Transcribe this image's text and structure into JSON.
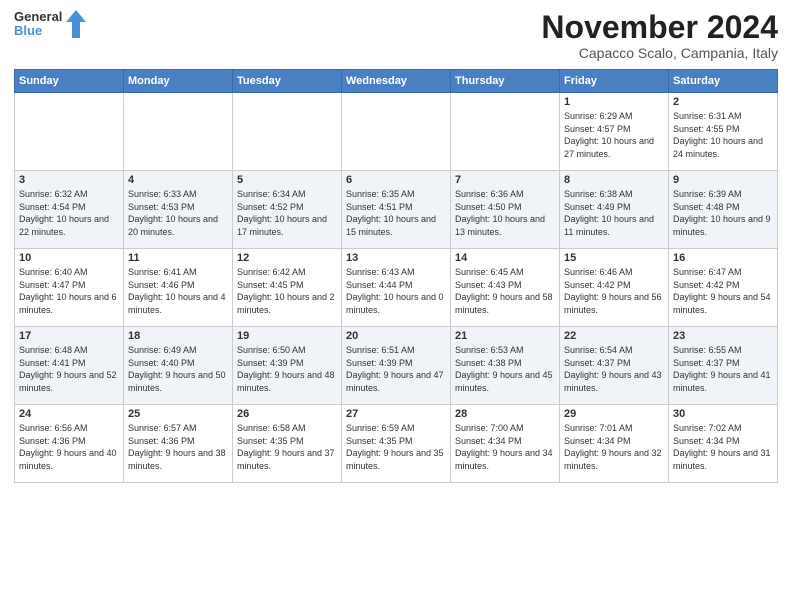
{
  "header": {
    "logo_general": "General",
    "logo_blue": "Blue",
    "month_title": "November 2024",
    "location": "Capacco Scalo, Campania, Italy"
  },
  "weekdays": [
    "Sunday",
    "Monday",
    "Tuesday",
    "Wednesday",
    "Thursday",
    "Friday",
    "Saturday"
  ],
  "weeks": [
    [
      {
        "day": "",
        "sunrise": "",
        "sunset": "",
        "daylight": ""
      },
      {
        "day": "",
        "sunrise": "",
        "sunset": "",
        "daylight": ""
      },
      {
        "day": "",
        "sunrise": "",
        "sunset": "",
        "daylight": ""
      },
      {
        "day": "",
        "sunrise": "",
        "sunset": "",
        "daylight": ""
      },
      {
        "day": "",
        "sunrise": "",
        "sunset": "",
        "daylight": ""
      },
      {
        "day": "1",
        "sunrise": "Sunrise: 6:29 AM",
        "sunset": "Sunset: 4:57 PM",
        "daylight": "Daylight: 10 hours and 27 minutes."
      },
      {
        "day": "2",
        "sunrise": "Sunrise: 6:31 AM",
        "sunset": "Sunset: 4:55 PM",
        "daylight": "Daylight: 10 hours and 24 minutes."
      }
    ],
    [
      {
        "day": "3",
        "sunrise": "Sunrise: 6:32 AM",
        "sunset": "Sunset: 4:54 PM",
        "daylight": "Daylight: 10 hours and 22 minutes."
      },
      {
        "day": "4",
        "sunrise": "Sunrise: 6:33 AM",
        "sunset": "Sunset: 4:53 PM",
        "daylight": "Daylight: 10 hours and 20 minutes."
      },
      {
        "day": "5",
        "sunrise": "Sunrise: 6:34 AM",
        "sunset": "Sunset: 4:52 PM",
        "daylight": "Daylight: 10 hours and 17 minutes."
      },
      {
        "day": "6",
        "sunrise": "Sunrise: 6:35 AM",
        "sunset": "Sunset: 4:51 PM",
        "daylight": "Daylight: 10 hours and 15 minutes."
      },
      {
        "day": "7",
        "sunrise": "Sunrise: 6:36 AM",
        "sunset": "Sunset: 4:50 PM",
        "daylight": "Daylight: 10 hours and 13 minutes."
      },
      {
        "day": "8",
        "sunrise": "Sunrise: 6:38 AM",
        "sunset": "Sunset: 4:49 PM",
        "daylight": "Daylight: 10 hours and 11 minutes."
      },
      {
        "day": "9",
        "sunrise": "Sunrise: 6:39 AM",
        "sunset": "Sunset: 4:48 PM",
        "daylight": "Daylight: 10 hours and 9 minutes."
      }
    ],
    [
      {
        "day": "10",
        "sunrise": "Sunrise: 6:40 AM",
        "sunset": "Sunset: 4:47 PM",
        "daylight": "Daylight: 10 hours and 6 minutes."
      },
      {
        "day": "11",
        "sunrise": "Sunrise: 6:41 AM",
        "sunset": "Sunset: 4:46 PM",
        "daylight": "Daylight: 10 hours and 4 minutes."
      },
      {
        "day": "12",
        "sunrise": "Sunrise: 6:42 AM",
        "sunset": "Sunset: 4:45 PM",
        "daylight": "Daylight: 10 hours and 2 minutes."
      },
      {
        "day": "13",
        "sunrise": "Sunrise: 6:43 AM",
        "sunset": "Sunset: 4:44 PM",
        "daylight": "Daylight: 10 hours and 0 minutes."
      },
      {
        "day": "14",
        "sunrise": "Sunrise: 6:45 AM",
        "sunset": "Sunset: 4:43 PM",
        "daylight": "Daylight: 9 hours and 58 minutes."
      },
      {
        "day": "15",
        "sunrise": "Sunrise: 6:46 AM",
        "sunset": "Sunset: 4:42 PM",
        "daylight": "Daylight: 9 hours and 56 minutes."
      },
      {
        "day": "16",
        "sunrise": "Sunrise: 6:47 AM",
        "sunset": "Sunset: 4:42 PM",
        "daylight": "Daylight: 9 hours and 54 minutes."
      }
    ],
    [
      {
        "day": "17",
        "sunrise": "Sunrise: 6:48 AM",
        "sunset": "Sunset: 4:41 PM",
        "daylight": "Daylight: 9 hours and 52 minutes."
      },
      {
        "day": "18",
        "sunrise": "Sunrise: 6:49 AM",
        "sunset": "Sunset: 4:40 PM",
        "daylight": "Daylight: 9 hours and 50 minutes."
      },
      {
        "day": "19",
        "sunrise": "Sunrise: 6:50 AM",
        "sunset": "Sunset: 4:39 PM",
        "daylight": "Daylight: 9 hours and 48 minutes."
      },
      {
        "day": "20",
        "sunrise": "Sunrise: 6:51 AM",
        "sunset": "Sunset: 4:39 PM",
        "daylight": "Daylight: 9 hours and 47 minutes."
      },
      {
        "day": "21",
        "sunrise": "Sunrise: 6:53 AM",
        "sunset": "Sunset: 4:38 PM",
        "daylight": "Daylight: 9 hours and 45 minutes."
      },
      {
        "day": "22",
        "sunrise": "Sunrise: 6:54 AM",
        "sunset": "Sunset: 4:37 PM",
        "daylight": "Daylight: 9 hours and 43 minutes."
      },
      {
        "day": "23",
        "sunrise": "Sunrise: 6:55 AM",
        "sunset": "Sunset: 4:37 PM",
        "daylight": "Daylight: 9 hours and 41 minutes."
      }
    ],
    [
      {
        "day": "24",
        "sunrise": "Sunrise: 6:56 AM",
        "sunset": "Sunset: 4:36 PM",
        "daylight": "Daylight: 9 hours and 40 minutes."
      },
      {
        "day": "25",
        "sunrise": "Sunrise: 6:57 AM",
        "sunset": "Sunset: 4:36 PM",
        "daylight": "Daylight: 9 hours and 38 minutes."
      },
      {
        "day": "26",
        "sunrise": "Sunrise: 6:58 AM",
        "sunset": "Sunset: 4:35 PM",
        "daylight": "Daylight: 9 hours and 37 minutes."
      },
      {
        "day": "27",
        "sunrise": "Sunrise: 6:59 AM",
        "sunset": "Sunset: 4:35 PM",
        "daylight": "Daylight: 9 hours and 35 minutes."
      },
      {
        "day": "28",
        "sunrise": "Sunrise: 7:00 AM",
        "sunset": "Sunset: 4:34 PM",
        "daylight": "Daylight: 9 hours and 34 minutes."
      },
      {
        "day": "29",
        "sunrise": "Sunrise: 7:01 AM",
        "sunset": "Sunset: 4:34 PM",
        "daylight": "Daylight: 9 hours and 32 minutes."
      },
      {
        "day": "30",
        "sunrise": "Sunrise: 7:02 AM",
        "sunset": "Sunset: 4:34 PM",
        "daylight": "Daylight: 9 hours and 31 minutes."
      }
    ]
  ]
}
